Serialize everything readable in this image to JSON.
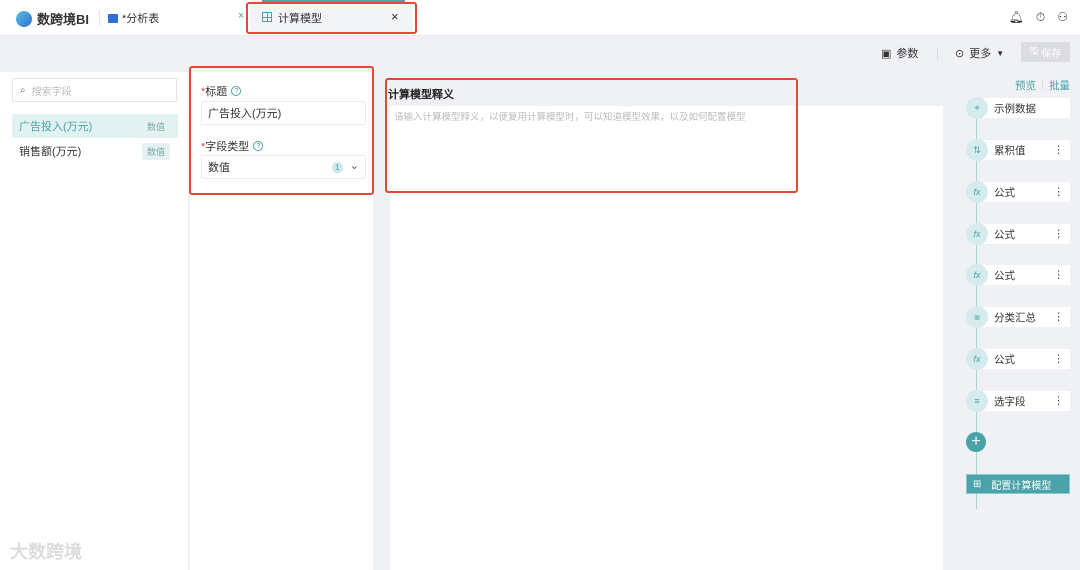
{
  "app": {
    "name": "数跨境BI"
  },
  "tabs": [
    {
      "label": "*分析表",
      "close": "×"
    },
    {
      "label": "计算模型",
      "close": "×"
    }
  ],
  "toolbar": {
    "params": "参数",
    "more": "更多",
    "save": "保存"
  },
  "left": {
    "search_placeholder": "搜索字段",
    "fields": [
      {
        "name": "广告投入(万元)",
        "type": "数值"
      },
      {
        "name": "销售额(万元)",
        "type": "数值"
      }
    ]
  },
  "form": {
    "title_label": "标题",
    "title_value": "广告投入(万元)",
    "type_label": "字段类型",
    "type_value": "数值",
    "type_count": "1"
  },
  "description": {
    "heading": "计算模型释义",
    "placeholder": "请输入计算模型释义，以便复用计算模型时，可以知道模型效果，以及如何配置模型"
  },
  "right": {
    "preview": "预览",
    "batch": "批量",
    "steps": [
      {
        "label": "示例数据",
        "icon": "target-icon"
      },
      {
        "label": "累积值",
        "icon": "cumulative-icon"
      },
      {
        "label": "公式",
        "icon": "formula-icon"
      },
      {
        "label": "公式",
        "icon": "formula-icon"
      },
      {
        "label": "公式",
        "icon": "formula-icon"
      },
      {
        "label": "分类汇总",
        "icon": "hierarchy-icon"
      },
      {
        "label": "公式",
        "icon": "formula-icon"
      },
      {
        "label": "选字段",
        "icon": "select-fields-icon"
      }
    ],
    "configure": "配置计算模型"
  },
  "watermark": "大数跨境",
  "colors": {
    "accent": "#4aa3a8",
    "annotation": "#e04a36"
  }
}
